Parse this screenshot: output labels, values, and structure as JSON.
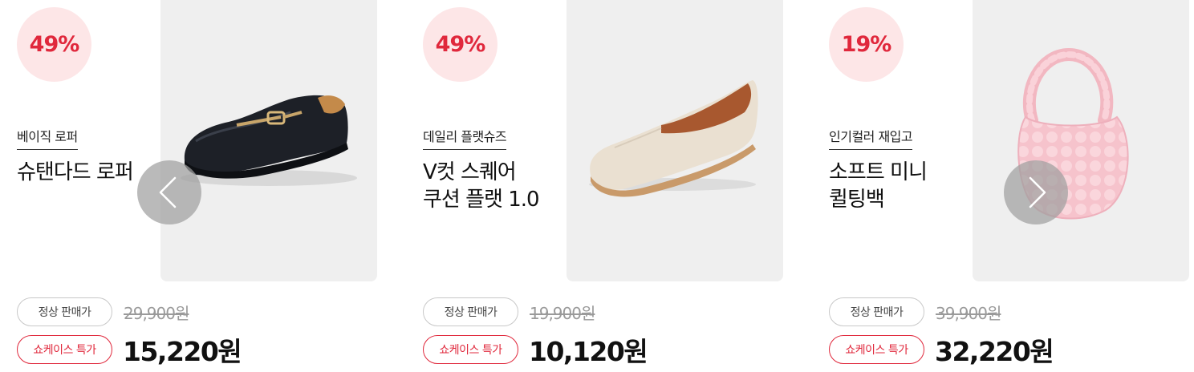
{
  "carousel": {
    "prev_icon": "chevron-left-icon",
    "next_icon": "chevron-right-icon",
    "products": [
      {
        "discount": "49%",
        "category": "베이직 로퍼",
        "name": "슈탠다드 로퍼",
        "regular_label": "정상 판매가",
        "regular_price": "29,900원",
        "sale_label": "쇼케이스 특가",
        "sale_price": "15,220원",
        "image": "black-loafer"
      },
      {
        "discount": "49%",
        "category": "데일리 플랫슈즈",
        "name": "V컷 스퀘어\n쿠션 플랫 1.0",
        "regular_label": "정상 판매가",
        "regular_price": "19,900원",
        "sale_label": "쇼케이스 특가",
        "sale_price": "10,120원",
        "image": "cream-flat-shoe"
      },
      {
        "discount": "19%",
        "category": "인기컬러 재입고",
        "name": "소프트 미니\n퀼팅백",
        "regular_label": "정상 판매가",
        "regular_price": "39,900원",
        "sale_label": "쇼케이스 특가",
        "sale_price": "32,220원",
        "image": "pink-quilted-bag"
      }
    ]
  },
  "colors": {
    "accent_red": "#e0283c",
    "badge_bg": "#fde6e7",
    "image_bg": "#efefef"
  }
}
